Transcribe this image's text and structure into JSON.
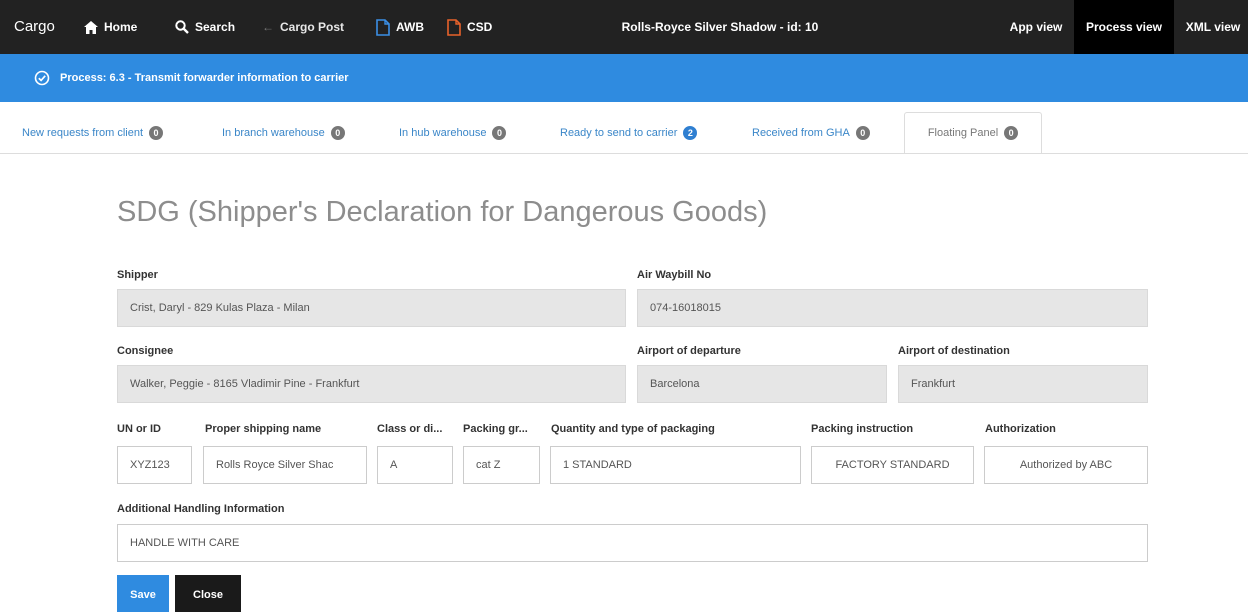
{
  "app": {
    "brand": "Cargo"
  },
  "topnav": {
    "home": "Home",
    "search": "Search",
    "cargo_post": "Cargo Post",
    "awb": "AWB",
    "csd": "CSD"
  },
  "record_title": "Rolls-Royce Silver Shadow - id: 10",
  "views": {
    "app": "App view",
    "process": "Process view",
    "xml": "XML view"
  },
  "process": {
    "text": "Process: 6.3 - Transmit forwarder information to carrier"
  },
  "tabs": [
    {
      "label": "New requests from client",
      "count": "0"
    },
    {
      "label": "In branch warehouse",
      "count": "0"
    },
    {
      "label": "In hub warehouse",
      "count": "0"
    },
    {
      "label": "Ready to send to carrier",
      "count": "2"
    },
    {
      "label": "Received from GHA",
      "count": "0"
    },
    {
      "label": "Floating Panel",
      "count": "0"
    }
  ],
  "form": {
    "title": "SDG (Shipper's Declaration for Dangerous Goods)",
    "shipper": {
      "label": "Shipper",
      "value": "Crist, Daryl - 829 Kulas Plaza - Milan"
    },
    "awb_no": {
      "label": "Air Waybill No",
      "value": "074-16018015"
    },
    "consignee": {
      "label": "Consignee",
      "value": "Walker, Peggie - 8165 Vladimir Pine - Frankfurt"
    },
    "departure": {
      "label": "Airport of departure",
      "value": "Barcelona"
    },
    "destination": {
      "label": "Airport of destination",
      "value": "Frankfurt"
    },
    "un_id": {
      "label": "UN or ID",
      "value": "XYZ123"
    },
    "shipping_name": {
      "label": "Proper shipping name",
      "value": "Rolls Royce Silver Shac"
    },
    "class_div": {
      "label": "Class or di...",
      "value": "A"
    },
    "packing_group": {
      "label": "Packing gr...",
      "value": "cat Z"
    },
    "quantity": {
      "label": "Quantity and type of packaging",
      "value": "1 STANDARD"
    },
    "packing_instruction": {
      "label": "Packing instruction",
      "value": "FACTORY STANDARD"
    },
    "authorization": {
      "label": "Authorization",
      "value": "Authorized by ABC"
    },
    "handling": {
      "label": "Additional Handling Information",
      "value": "HANDLE WITH CARE"
    }
  },
  "buttons": {
    "save": "Save",
    "close": "Close"
  },
  "colors": {
    "topbar": "#222222",
    "accent": "#2f8be0",
    "tab_link": "#3a86c8",
    "readonly_bg": "#e6e6e6"
  }
}
